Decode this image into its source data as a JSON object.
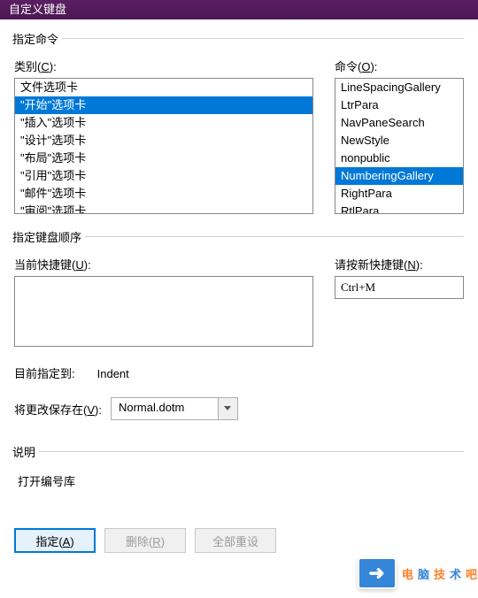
{
  "window": {
    "title": "自定义键盘"
  },
  "sections": {
    "specify_command": "指定命令",
    "specify_keyboard_sequence": "指定键盘顺序",
    "description": "说明"
  },
  "labels": {
    "categories_prefix": "类别(",
    "categories_accel": "C",
    "categories_suffix": "):",
    "commands_prefix": "命令(",
    "commands_accel": "O",
    "commands_suffix": "):",
    "current_keys_prefix": "当前快捷键(",
    "current_keys_accel": "U",
    "current_keys_suffix": "):",
    "new_key_prefix": "请按新快捷键(",
    "new_key_accel": "N",
    "new_key_suffix": "):",
    "assigned_to": "目前指定到:",
    "save_in_prefix": "将更改保存在(",
    "save_in_accel": "V",
    "save_in_suffix": "):"
  },
  "categories": [
    "文件选项卡",
    "\"开始\"选项卡",
    "\"插入\"选项卡",
    "\"设计\"选项卡",
    "\"布局\"选项卡",
    "\"引用\"选项卡",
    "\"邮件\"选项卡",
    "\"审阅\"选项卡"
  ],
  "categories_selected_index": 1,
  "commands": [
    "LineSpacingGallery",
    "LtrPara",
    "NavPaneSearch",
    "NewStyle",
    "nonpublic",
    "NumberingGallery",
    "RightPara",
    "RtlPara"
  ],
  "commands_selected_index": 5,
  "new_shortcut_value": "Ctrl+M",
  "currently_assigned_to": "Indent",
  "save_in_value": "Normal.dotm",
  "description_text": "打开编号库",
  "buttons": {
    "assign_prefix": "指定(",
    "assign_accel": "A",
    "assign_suffix": ")",
    "remove_prefix": "删除(",
    "remove_accel": "R",
    "remove_suffix": ")",
    "reset_all": "全部重设"
  },
  "watermark": {
    "chars": [
      "电",
      "脑",
      "技",
      "术",
      "吧"
    ],
    "icon_text": "➜"
  }
}
